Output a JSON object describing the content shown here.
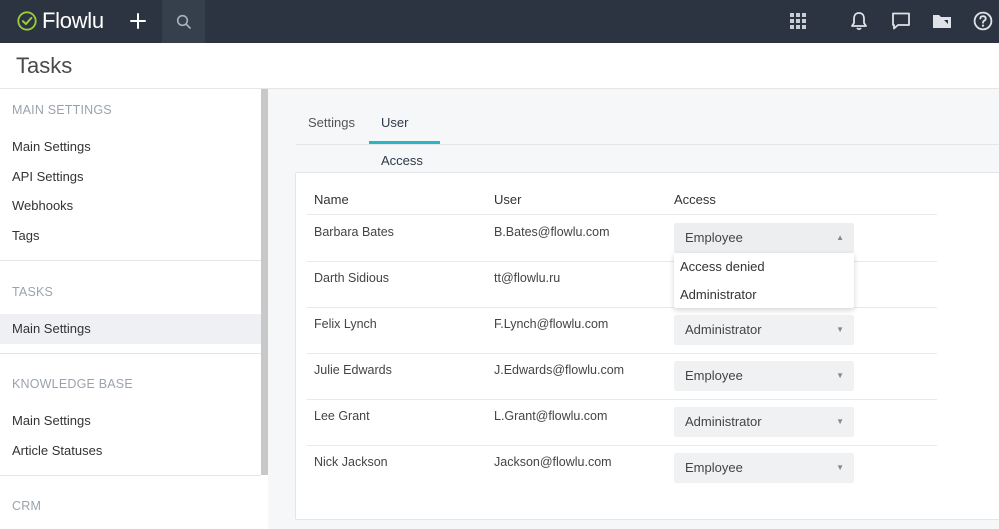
{
  "app": {
    "name": "Flowlu"
  },
  "topbar": {
    "icons": [
      "add-icon",
      "search-icon",
      "apps-grid-icon",
      "bell-icon",
      "chat-icon",
      "folder-icon",
      "help-icon"
    ]
  },
  "page": {
    "title": "Tasks"
  },
  "sidebar": {
    "sections": [
      {
        "heading": "MAIN SETTINGS",
        "items": [
          "Main Settings",
          "API Settings",
          "Webhooks",
          "Tags"
        ]
      },
      {
        "heading": "TASKS",
        "items": [
          "Main Settings"
        ]
      },
      {
        "heading": "KNOWLEDGE BASE",
        "items": [
          "Main Settings",
          "Article Statuses"
        ]
      },
      {
        "heading": "CRM",
        "items": []
      }
    ]
  },
  "tabs": [
    "Settings",
    "User Access Settings"
  ],
  "table": {
    "headers": [
      "Name",
      "User",
      "Access"
    ],
    "rows": [
      {
        "name": "Barbara Bates",
        "user": "B.Bates@flowlu.com",
        "access": "Employee"
      },
      {
        "name": "Darth Sidious",
        "user": "tt@flowlu.ru",
        "access": ""
      },
      {
        "name": "Felix Lynch",
        "user": "F.Lynch@flowlu.com",
        "access": "Administrator"
      },
      {
        "name": "Julie Edwards",
        "user": "J.Edwards@flowlu.com",
        "access": "Employee"
      },
      {
        "name": "Lee Grant",
        "user": "L.Grant@flowlu.com",
        "access": "Administrator"
      },
      {
        "name": "Nick Jackson",
        "user": "Jackson@flowlu.com",
        "access": "Employee"
      }
    ]
  },
  "dropdown": {
    "options": [
      "Access denied",
      "Administrator"
    ]
  },
  "colors": {
    "topbar": "#2b3440",
    "accent": "#27b6c2",
    "logo_check": "#9ccc3c"
  }
}
